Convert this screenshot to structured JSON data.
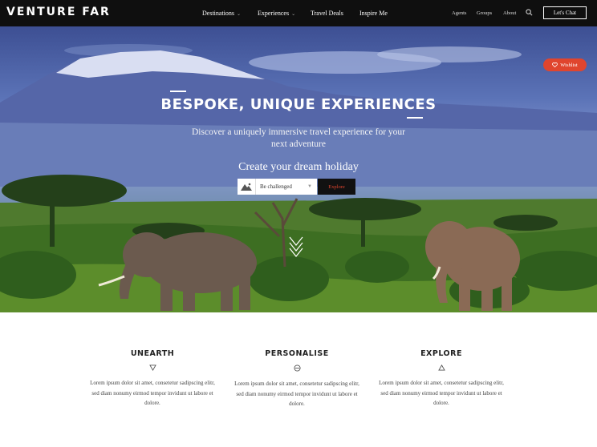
{
  "nav": {
    "logo": "VENTURE FAR",
    "items": [
      {
        "label": "Destinations",
        "caret": "⌄"
      },
      {
        "label": "Experiences",
        "caret": "⌄"
      },
      {
        "label": "Travel Deals"
      },
      {
        "label": "Inspire Me"
      }
    ],
    "secondary": [
      "Agents",
      "Groups",
      "About"
    ],
    "search_icon": "search-icon",
    "cta": "Let's Chat"
  },
  "hero": {
    "wishlist": "Wishlist",
    "headline": "BESPOKE, UNIQUE EXPERIENCES",
    "subtitle": "Discover a uniquely immersive travel experience for your next adventure",
    "create": "Create your dream holiday",
    "select_value": "Be challenged",
    "explore_label": "Explore"
  },
  "features": [
    {
      "title": "UNEARTH",
      "icon": "triangle-down-icon",
      "text": "Lorem ipsum dolor sit amet, consetetur sadipscing elitr, sed diam nonumy eirmod tempor invidunt ut labore et dolore."
    },
    {
      "title": "PERSONALISE",
      "icon": "circle-icon",
      "text": "Lorem ipsum dolor sit amet, consetetur sadipscing elitr, sed diam nonumy eirmod tempor invidunt ut labore et dolore."
    },
    {
      "title": "EXPLORE",
      "icon": "triangle-up-icon",
      "text": "Lorem ipsum dolor sit amet, consetetur sadipscing elitr, sed diam nonumy eirmod tempor invidunt ut labore et dolore."
    }
  ],
  "colors": {
    "accent": "#e0452e",
    "nav_bg": "#0f0f0f"
  }
}
